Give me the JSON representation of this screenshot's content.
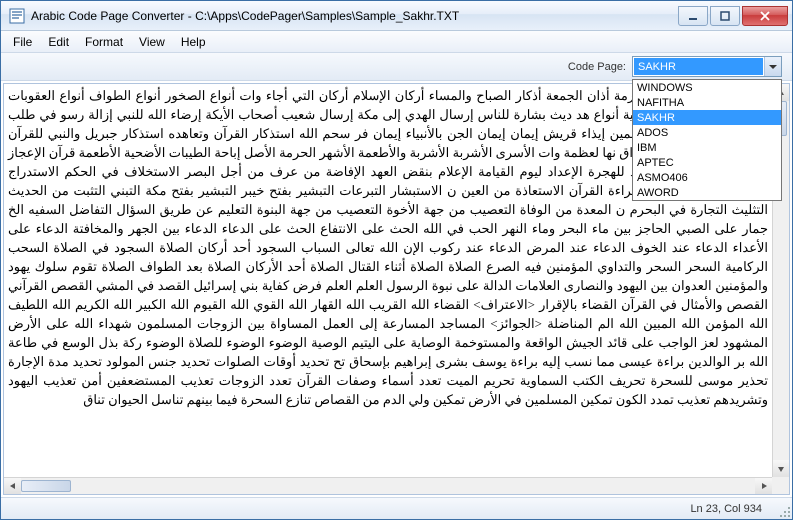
{
  "window": {
    "title": "Arabic Code Page Converter - C:\\Apps\\CodePager\\Samples\\Sample_Sakhr.TXT"
  },
  "menu": {
    "items": [
      "File",
      "Edit",
      "Format",
      "View",
      "Help"
    ]
  },
  "toolbar": {
    "codepage_label": "Code Page:",
    "codepage_value": "SAKHR"
  },
  "dropdown": {
    "items": [
      "WINDOWS",
      "NAFITHA",
      "SAKHR",
      "ADOS",
      "IBM",
      "APTEC",
      "ASMO406",
      "AWORD"
    ],
    "selected": "SAKHR"
  },
  "content": {
    "text": "رون وات الصيد أدوية محرمة أذان الجمعة أذكار الصباح والمساء أركان الإسلام أركان التي أجاء وات أنواع الصخور أنواع الطواف أنواع العقوبات أنواع الفتن أنواع من الأدوية أنواع هد ديث بشارة للناس إرسال الهدي إلى مكة إرسال شعيب أصحاب الأيكة إرضاء الله للنبي إزالة رسو في طلب الإسلام إيذاء اليهود للمسلمين إيذاء قريش إيمان إيمان الجن بالأنبياء إيمان فر سحم الله استذكار القرآن وتعاهده استذكار جبريل والنبي للقرآن استراق الجن للسمع استراق نها لعظمة وات الأسرى الأشربة الأشربة والأطعمة الأشهر الحرمة الأصل إباحة الطيبات الأضحية الأطعمة قرآن الإعجاز اللغوي في القرآن الإعداد للهجرة الإعداد ليوم القيامة الإعلام بنقض العهد الإفاضة من عرف من أجل البصر الاستخلاف في الحكم الاستدراج الاستعاذة الاستعاذة عند قراءة القرآن الاستعاذة من العين ن الاستبشار التبرعات التبشير بفتح خيبر التبشير بفتح مكة التبني التثبت من الحديث التثليث التجارة في البحرم ن المعدة من الوفاة التعصيب من جهة الأخوة التعصيب من جهة البنوة التعليم عن طريق السؤال التفاضل السفيه الخ جمار على الصبي الحاجز بين ماء البحر وماء النهر الحب في الله الحث على الانتفاع الحث على الدعاء الدعاء بين الجهر والمخافتة الدعاء على الأعداء الدعاء عند الخوف الدعاء عند المرض الدعاء عند ركوب الإن الله تعالى السباب السجود أحد أركان الصلاة السجود في الصلاة السحب الركامية السحر السحر والتداوي المؤمنين فيه الصرع الصلاة الصلاة أثناء القتال الصلاة أحد الأركان الصلاة بعد الطواف الصلاة تقوم سلوك يهود والمؤمنين العدوان بين اليهود والنصارى العلامات الدالة على نبوة الرسول العلم العلم فرض كفاية بني إسرائيل القصد في المشي القصص القرآني القصص والأمثال في القرآن القضاء بالإقرار <الاعتراف> القضاء الله القريب الله القهار الله القوي الله القيوم الله الكبير الله الكريم الله اللطيف الله المؤمن الله المبين الله الم المناضلة <الجوائز> المساجد المسارعة إلى العمل المساواة بين الزوجات المسلمون شهداء الله على الأرض المشهود لعز الواجب على قائد الجيش الواقعة والمستوخمة الوصاية على اليتيم الوصية الوضوء الوضوء للصلاة الوضوء ركة بذل الوسع في طاعة الله بر الوالدين براءة عيسى مما نسب إليه براءة يوسف بشرى إبراهيم بإسحاق تح تحديد أوقات الصلوات تحديد جنس المولود تحديد مدة الإجارة تحذير موسى للسحرة تحريف الكتب السماوية تحريم الميت تعدد أسماء وصفات القرآن تعدد الزوجات تعذيب المستضعفين أمن تعذيب اليهود وتشريدهم تعذيب تمدد الكون تمكين المسلمين في الأرض تمكين ولي الدم من القصاص تنازع السحرة فيما بينهم تناسل الحيوان تناق"
  },
  "status": {
    "position": "Ln 23, Col 934"
  }
}
